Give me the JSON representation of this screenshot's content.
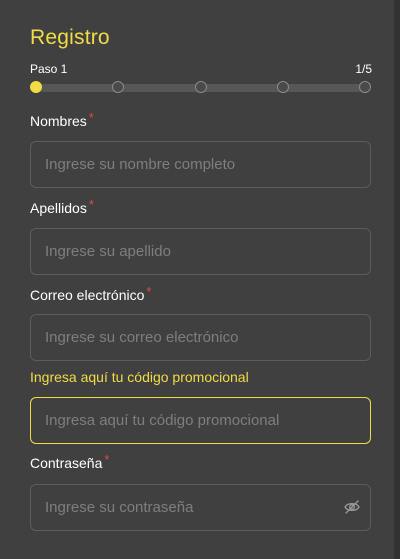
{
  "form": {
    "title": "Registro",
    "step_label": "Paso 1",
    "step_count": "1/5",
    "current_step": 1,
    "total_steps": 5
  },
  "fields": {
    "nombres": {
      "label": "Nombres",
      "required_mark": "*",
      "placeholder": "Ingrese su nombre completo",
      "value": ""
    },
    "apellidos": {
      "label": "Apellidos",
      "required_mark": "*",
      "placeholder": "Ingrese su apellido",
      "value": ""
    },
    "correo": {
      "label": "Correo electrónico",
      "required_mark": "*",
      "placeholder": "Ingrese su correo electrónico",
      "value": ""
    },
    "promo": {
      "label": "Ingresa aquí tu código promocional",
      "placeholder": "Ingresa aquí tu código promocional",
      "value": ""
    },
    "contrasena": {
      "label": "Contraseña",
      "required_mark": "*",
      "placeholder": "Ingrese su contraseña",
      "value": "",
      "toggle_icon": "eye-off-icon"
    }
  },
  "colors": {
    "background": "#404040",
    "accent": "#f2dc46",
    "required": "#e04848",
    "input_border": "#5c5c5c",
    "placeholder": "#7e7e7e"
  }
}
